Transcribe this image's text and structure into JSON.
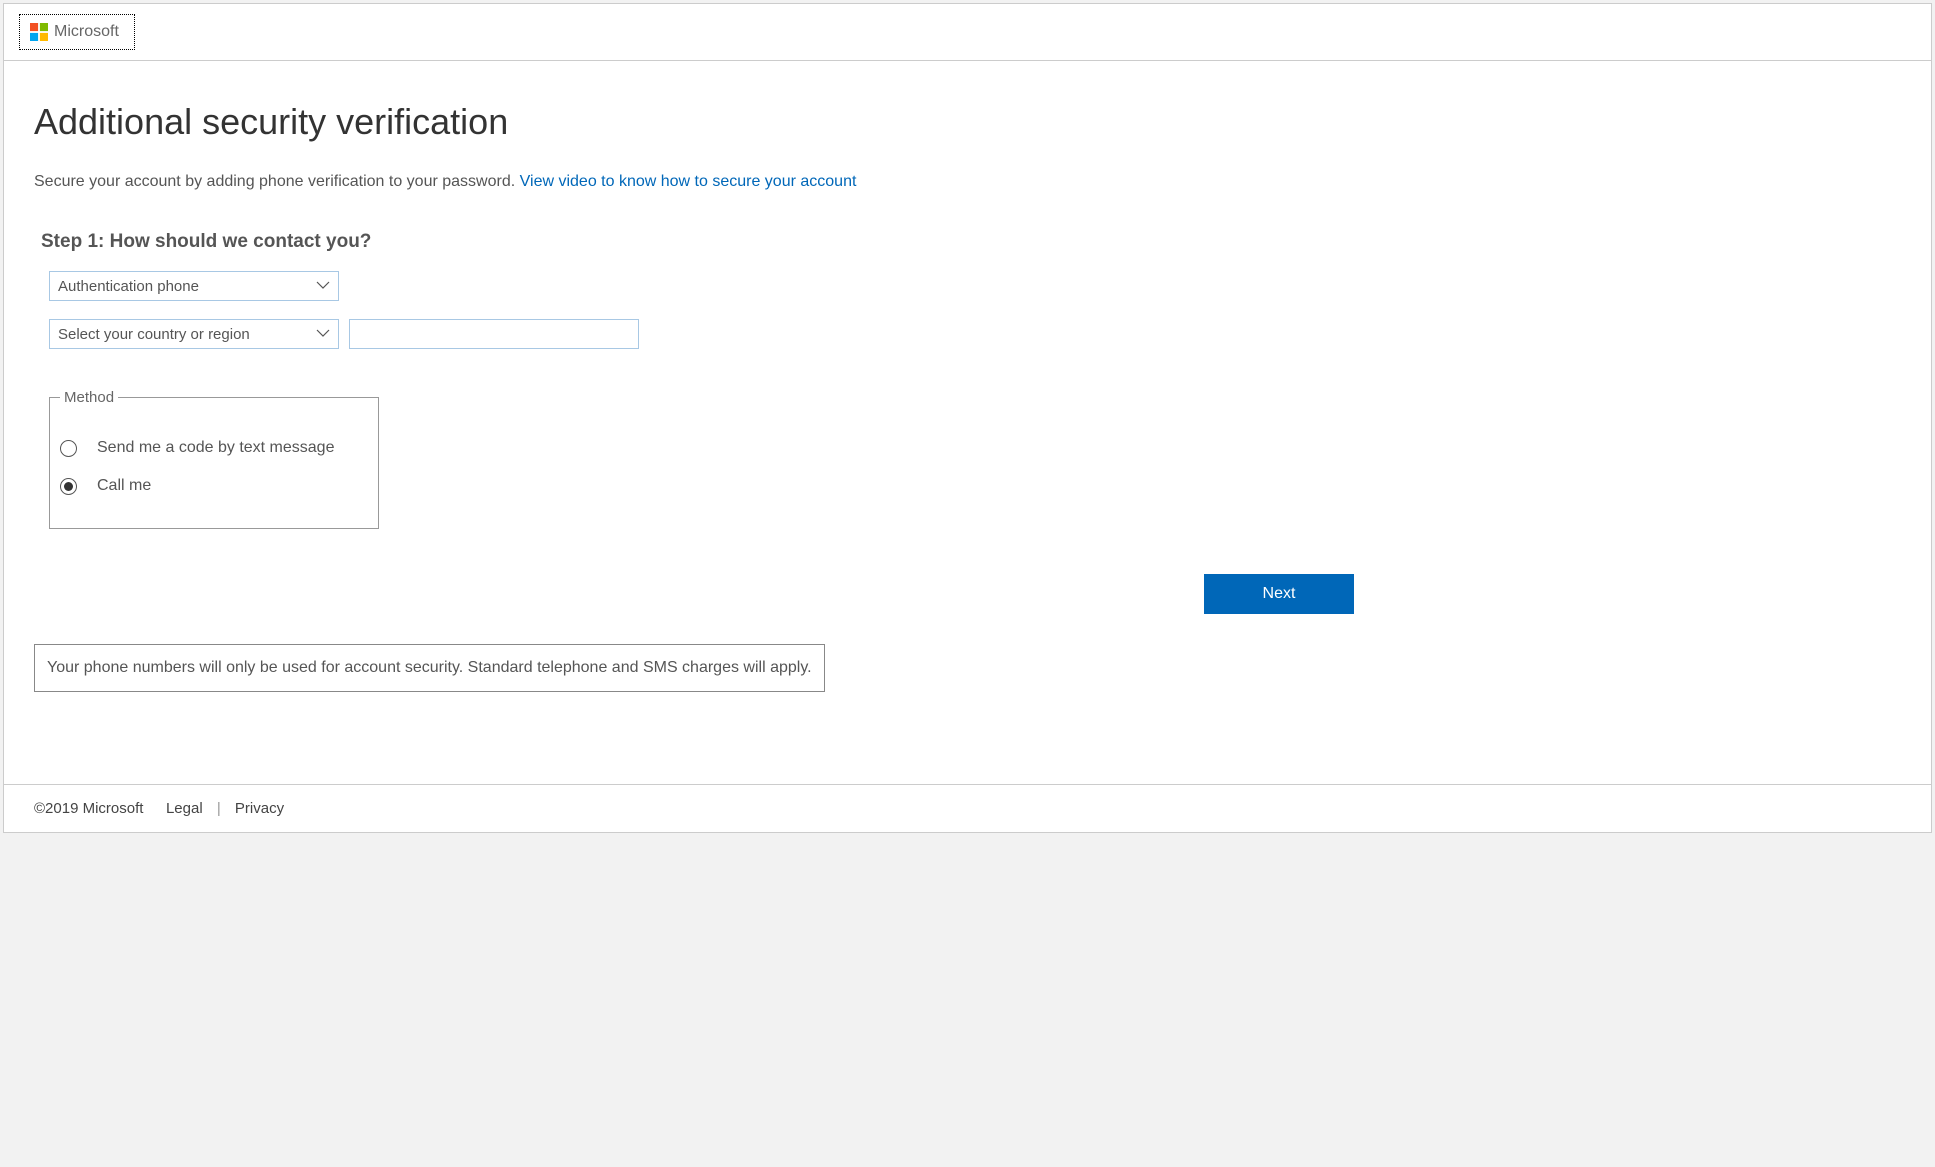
{
  "header": {
    "brand": "Microsoft"
  },
  "page": {
    "title": "Additional security verification",
    "intro_text": "Secure your account by adding phone verification to your password. ",
    "intro_link": "View video to know how to secure your account"
  },
  "step": {
    "heading": "Step 1: How should we contact you?"
  },
  "form": {
    "contact_method_selected": "Authentication phone",
    "country_placeholder": "Select your country or region",
    "phone_value": ""
  },
  "method": {
    "legend": "Method",
    "options": {
      "text": "Send me a code by text message",
      "call": "Call me"
    },
    "selected": "call"
  },
  "buttons": {
    "next": "Next"
  },
  "disclaimer": "Your phone numbers will only be used for account security. Standard telephone and SMS charges will apply.",
  "footer": {
    "copyright": "©2019 Microsoft",
    "legal": "Legal",
    "privacy": "Privacy"
  }
}
